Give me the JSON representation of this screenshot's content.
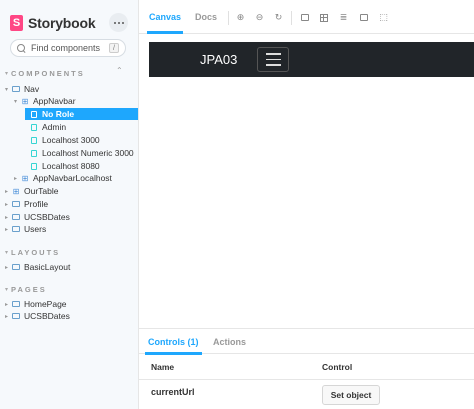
{
  "brand": {
    "name": "Storybook",
    "badge": "S"
  },
  "search": {
    "placeholder": "Find components",
    "shortcut": "/"
  },
  "sections": {
    "components": "COMPONENTS",
    "layouts": "LAYOUTS",
    "pages": "PAGES"
  },
  "tree": {
    "nav": "Nav",
    "appnavbar": "AppNavbar",
    "no_role": "No Role",
    "admin": "Admin",
    "localhost_3000": "Localhost 3000",
    "localhost_numeric_3000": "Localhost Numeric 3000",
    "localhost_8080": "Localhost 8080",
    "appnavbar_localhost": "AppNavbarLocalhost",
    "ourtable": "OurTable",
    "profile": "Profile",
    "ucsbdates": "UCSBDates",
    "users": "Users",
    "basiclayout": "BasicLayout",
    "homepage": "HomePage",
    "pages_ucsbdates": "UCSBDates"
  },
  "toolbar": {
    "tab_canvas": "Canvas",
    "tab_docs": "Docs"
  },
  "preview": {
    "brand": "JPA03"
  },
  "addons": {
    "tab_controls": "Controls (1)",
    "tab_actions": "Actions",
    "col_name": "Name",
    "col_control": "Control",
    "row_name": "currentUrl",
    "row_button": "Set object"
  },
  "colors": {
    "accent": "#1ea7fd",
    "storybook_pink": "#ff4785",
    "navbar_dark": "#212529"
  }
}
